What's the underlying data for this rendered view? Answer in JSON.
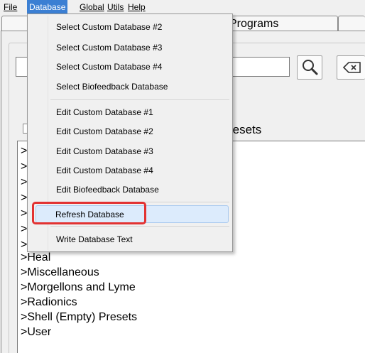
{
  "menubar": {
    "file": "File",
    "database": "Database",
    "global": "Global",
    "utils": "Utils",
    "help": "Help"
  },
  "tabs": {
    "programs": "Programs"
  },
  "presets_label": "resets",
  "database_menu": {
    "items": [
      "Select Custom Database #2",
      "Select Custom Database #3",
      "Select Custom Database #4",
      "Select Biofeedback Database",
      "Edit Custom Database #1",
      "Edit Custom Database #2",
      "Edit Custom Database #3",
      "Edit Custom Database #4",
      "Edit Biofeedback Database",
      "Refresh Database",
      "Write Database Text"
    ]
  },
  "list": {
    "partial_prefix": ">",
    "rows": [
      ">Heal",
      ">Miscellaneous",
      ">Morgellons and Lyme",
      ">Radionics",
      ">Shell (Empty) Presets",
      ">User"
    ]
  },
  "colors": {
    "menu_active": "#3b7fd3",
    "hover_fill": "#dcebfc",
    "highlight_border": "#e23232"
  }
}
